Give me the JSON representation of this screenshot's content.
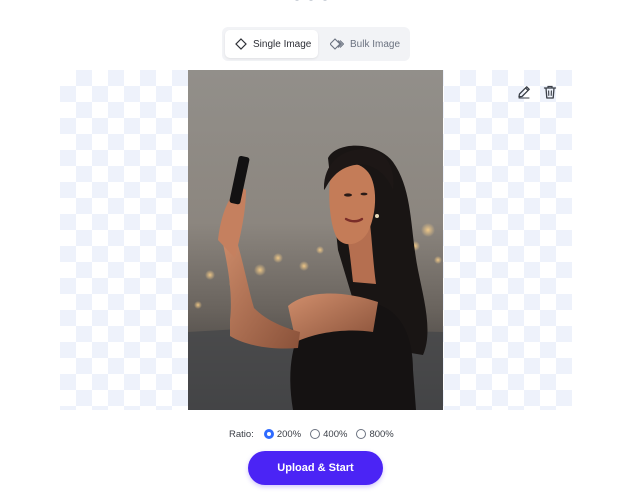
{
  "mode_switch": {
    "single_label": "Single Image",
    "bulk_label": "Bulk Image",
    "active": "single"
  },
  "preview": {
    "toolbar": {
      "edit_icon": "pencil-icon",
      "delete_icon": "trash-icon"
    }
  },
  "ratio": {
    "label": "Ratio:",
    "options": [
      {
        "label": "200%",
        "selected": true
      },
      {
        "label": "400%",
        "selected": false
      },
      {
        "label": "800%",
        "selected": false
      }
    ]
  },
  "upload_button": {
    "label": "Upload & Start"
  },
  "colors": {
    "accent": "#4b24f5",
    "radio_selected": "#2f6bff",
    "checker": "#eef2fb"
  }
}
